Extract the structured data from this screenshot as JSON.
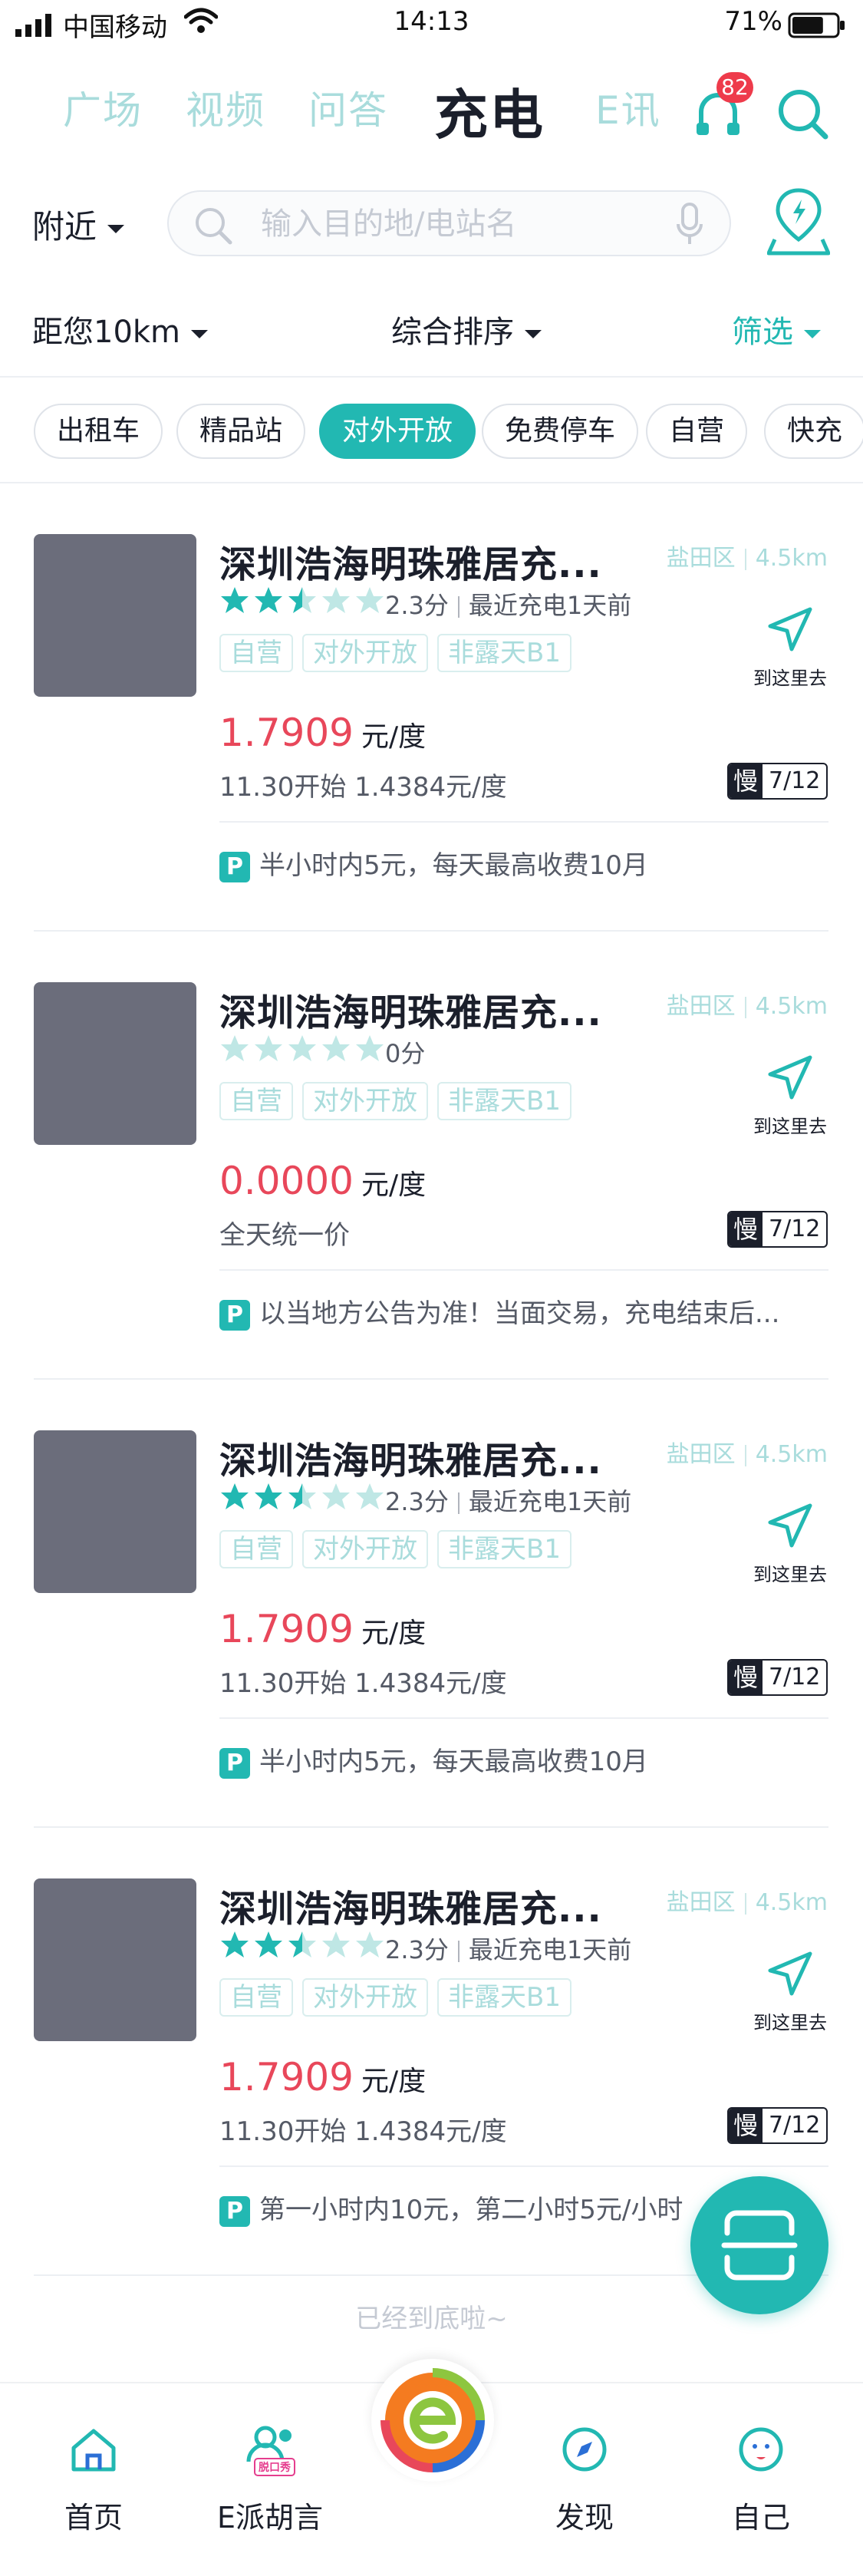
{
  "status_bar": {
    "carrier": "中国移动",
    "time": "14:13",
    "battery": "71%",
    "battery_level": 0.71
  },
  "top_tabs": [
    {
      "label": "广场",
      "active": false
    },
    {
      "label": "视频",
      "active": false
    },
    {
      "label": "问答",
      "active": false
    },
    {
      "label": "充电",
      "active": true
    },
    {
      "label": "E讯",
      "active": false
    }
  ],
  "notification_badge": "82",
  "search": {
    "location": "附近",
    "placeholder": "输入目的地/电站名"
  },
  "filters": {
    "distance": "距您10km",
    "sort": "综合排序",
    "screen": "筛选"
  },
  "chips": [
    {
      "label": "出租车",
      "active": false
    },
    {
      "label": "精品站",
      "active": false
    },
    {
      "label": "对外开放",
      "active": true
    },
    {
      "label": "免费停车",
      "active": false
    },
    {
      "label": "自营",
      "active": false
    },
    {
      "label": "快充",
      "active": false
    }
  ],
  "stations": [
    {
      "name": "深圳浩海明珠雅居充...",
      "district": "盐田区",
      "distance": "4.5km",
      "rating": 2.5,
      "score": "2.3分",
      "last_charge": "最近充电1天前",
      "tags": [
        "自营",
        "对外开放",
        "非露天B1"
      ],
      "navigate_label": "到这里去",
      "price": "1.7909",
      "price_unit": "元/度",
      "sub_price": "11.30开始 1.4384元/度",
      "charger_type": "慢",
      "charger_count": "7/12",
      "parking": "半小时内5元，每天最高收费10月"
    },
    {
      "name": "深圳浩海明珠雅居充...",
      "district": "盐田区",
      "distance": "4.5km",
      "rating": 0,
      "score": "0分",
      "last_charge": "",
      "tags": [
        "自营",
        "对外开放",
        "非露天B1"
      ],
      "navigate_label": "到这里去",
      "price": "0.0000",
      "price_unit": "元/度",
      "sub_price": "全天统一价",
      "charger_type": "慢",
      "charger_count": "7/12",
      "parking": "以当地方公告为准！当面交易，充电结束后..."
    },
    {
      "name": "深圳浩海明珠雅居充...",
      "district": "盐田区",
      "distance": "4.5km",
      "rating": 2.5,
      "score": "2.3分",
      "last_charge": "最近充电1天前",
      "tags": [
        "自营",
        "对外开放",
        "非露天B1"
      ],
      "navigate_label": "到这里去",
      "price": "1.7909",
      "price_unit": "元/度",
      "sub_price": "11.30开始 1.4384元/度",
      "charger_type": "慢",
      "charger_count": "7/12",
      "parking": "半小时内5元，每天最高收费10月"
    },
    {
      "name": "深圳浩海明珠雅居充...",
      "district": "盐田区",
      "distance": "4.5km",
      "rating": 2.5,
      "score": "2.3分",
      "last_charge": "最近充电1天前",
      "tags": [
        "自营",
        "对外开放",
        "非露天B1"
      ],
      "navigate_label": "到这里去",
      "price": "1.7909",
      "price_unit": "元/度",
      "sub_price": "11.30开始 1.4384元/度",
      "charger_type": "慢",
      "charger_count": "7/12",
      "parking": "第一小时内10元，第二小时5元/小时"
    }
  ],
  "end_text": "已经到底啦~",
  "bottom_nav": [
    {
      "label": "首页",
      "icon": "home-icon"
    },
    {
      "label": "E派胡言",
      "icon": "talk-show-icon",
      "icon_text": "脱口秀"
    },
    {
      "label": "",
      "icon": "app-logo-icon"
    },
    {
      "label": "发现",
      "icon": "compass-icon"
    },
    {
      "label": "自己",
      "icon": "profile-icon"
    }
  ],
  "colors": {
    "accent": "#22b8b2",
    "price": "#e8475a",
    "tab_inactive": "#a9dcdc",
    "badge": "#ee3b4b",
    "thumbnail": "#6b6d7b"
  }
}
